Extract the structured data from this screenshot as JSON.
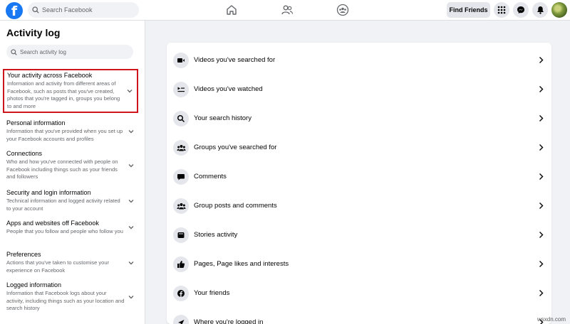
{
  "topbar": {
    "logo": "f",
    "search_placeholder": "Search Facebook",
    "nav_icons": [
      "home-icon",
      "friends-icon",
      "groups-icon"
    ],
    "find_friends_label": "Find Friends",
    "right_icons": [
      "menu-grid-icon",
      "messenger-icon",
      "notifications-icon"
    ]
  },
  "sidebar": {
    "title": "Activity log",
    "search_placeholder": "Search activity log",
    "categories": [
      {
        "title": "Your activity across Facebook",
        "desc": "Information and activity from different areas of Facebook, such as posts that you've created, photos that you're tagged in, groups you belong to and more",
        "active": true
      },
      {
        "title": "Personal information",
        "desc": "Information that you've provided when you set up your Facebook accounts and profiles",
        "active": false
      },
      {
        "title": "Connections",
        "desc": "Who and how you've connected with people on Facebook including things such as your friends and followers",
        "active": false
      },
      {
        "title": "Security and login information",
        "desc": "Technical information and logged activity related to your account",
        "active": false
      },
      {
        "title": "Apps and websites off Facebook",
        "desc": "People that you follow and people who follow you",
        "active": false
      },
      {
        "title": "Preferences",
        "desc": "Actions that you've taken to customise your experience on Facebook",
        "active": false
      },
      {
        "title": "Logged information",
        "desc": "Information that Facebook logs about your activity, including things such as your location and search history",
        "active": false
      }
    ]
  },
  "main": {
    "rows": [
      {
        "label": "Videos you've searched for",
        "icon": "video-camera-icon"
      },
      {
        "label": "Videos you've watched",
        "icon": "video-playlist-icon"
      },
      {
        "label": "Your search history",
        "icon": "search-icon"
      },
      {
        "label": "Groups you've searched for",
        "icon": "groups-icon"
      },
      {
        "label": "Comments",
        "icon": "comment-icon"
      },
      {
        "label": "Group posts and comments",
        "icon": "groups-icon"
      },
      {
        "label": "Stories activity",
        "icon": "stories-icon"
      },
      {
        "label": "Pages, Page likes and interests",
        "icon": "like-icon"
      },
      {
        "label": "Your friends",
        "icon": "facebook-icon"
      },
      {
        "label": "Where you're logged in",
        "icon": "location-icon"
      }
    ]
  },
  "watermark": "wsxdn.com",
  "colors": {
    "brand": "#1877f2",
    "highlight_border": "#d0141c",
    "background": "#f0f2f5"
  }
}
